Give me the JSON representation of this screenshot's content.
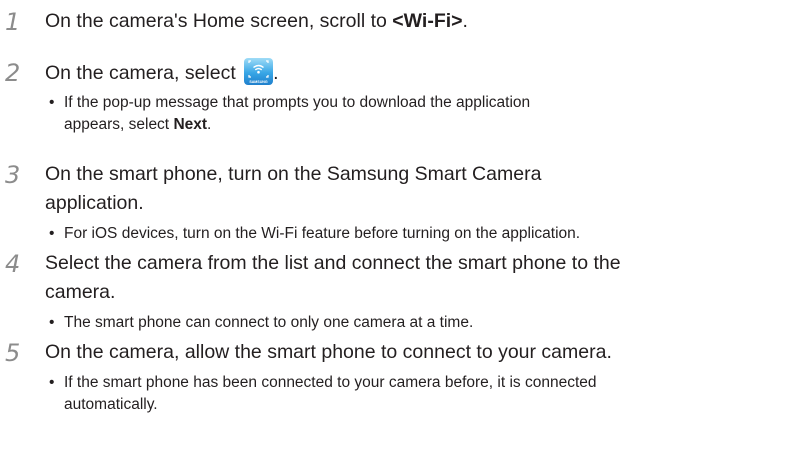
{
  "steps": [
    {
      "number": "1",
      "text_before": "On the camera's Home screen, scroll to ",
      "bold": "<Wi-Fi>",
      "text_after": "."
    },
    {
      "number": "2",
      "text_before": "On the camera, select ",
      "icon": "samsung-smart-camera-app-icon",
      "icon_label": "SAMSUNG",
      "text_after": ".",
      "bullet": {
        "line1": "If the pop-up message that prompts you to download the application",
        "line2_before": "appears, select ",
        "line2_bold": "Next",
        "line2_after": "."
      }
    },
    {
      "number": "3",
      "line1": "On the smart phone, turn on the Samsung Smart Camera",
      "line2": "application.",
      "bullet": "For iOS devices, turn on the Wi-Fi feature before turning on the application."
    },
    {
      "number": "4",
      "line1": "Select the camera from the list and connect the smart phone to the",
      "line2": "camera.",
      "bullet": "The smart phone can connect to only one camera at a time."
    },
    {
      "number": "5",
      "text": "On the camera, allow the smart phone to connect to your camera.",
      "bullet_line1": "If the smart phone has been connected to your camera before, it is connected",
      "bullet_line2": "automatically."
    }
  ]
}
